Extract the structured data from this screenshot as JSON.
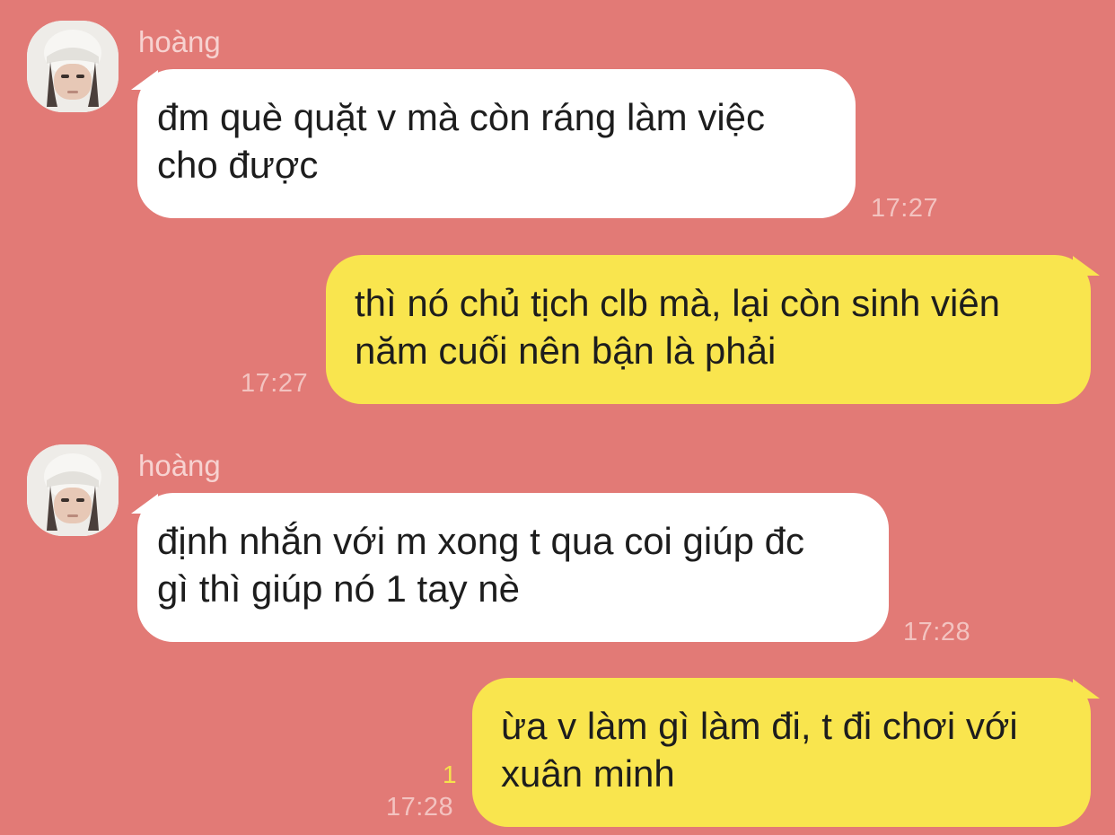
{
  "messages": [
    {
      "sender": "hoàng",
      "text": "đm què quặt v mà còn ráng làm việc\ncho được",
      "time": "17:27"
    },
    {
      "text": "thì nó chủ tịch clb mà, lại còn sinh viên\nnăm cuối nên bận là phải",
      "time": "17:27"
    },
    {
      "sender": "hoàng",
      "text": "định nhắn với m xong t qua coi giúp đc\ngì thì giúp nó 1 tay nè",
      "time": "17:28"
    },
    {
      "text": "ừa v làm gì làm đi, t đi chơi với\nxuân minh",
      "time": "17:28",
      "unread": "1"
    }
  ],
  "colors": {
    "background": "#e27a76",
    "incoming_bubble": "#ffffff",
    "outgoing_bubble": "#f9e54e",
    "timestamp": "#f3c3c0",
    "sender_name": "#f7d2d0",
    "unread_count": "#f5e34c"
  },
  "icons": {
    "avatar": "profile-photo-white-beanie"
  }
}
